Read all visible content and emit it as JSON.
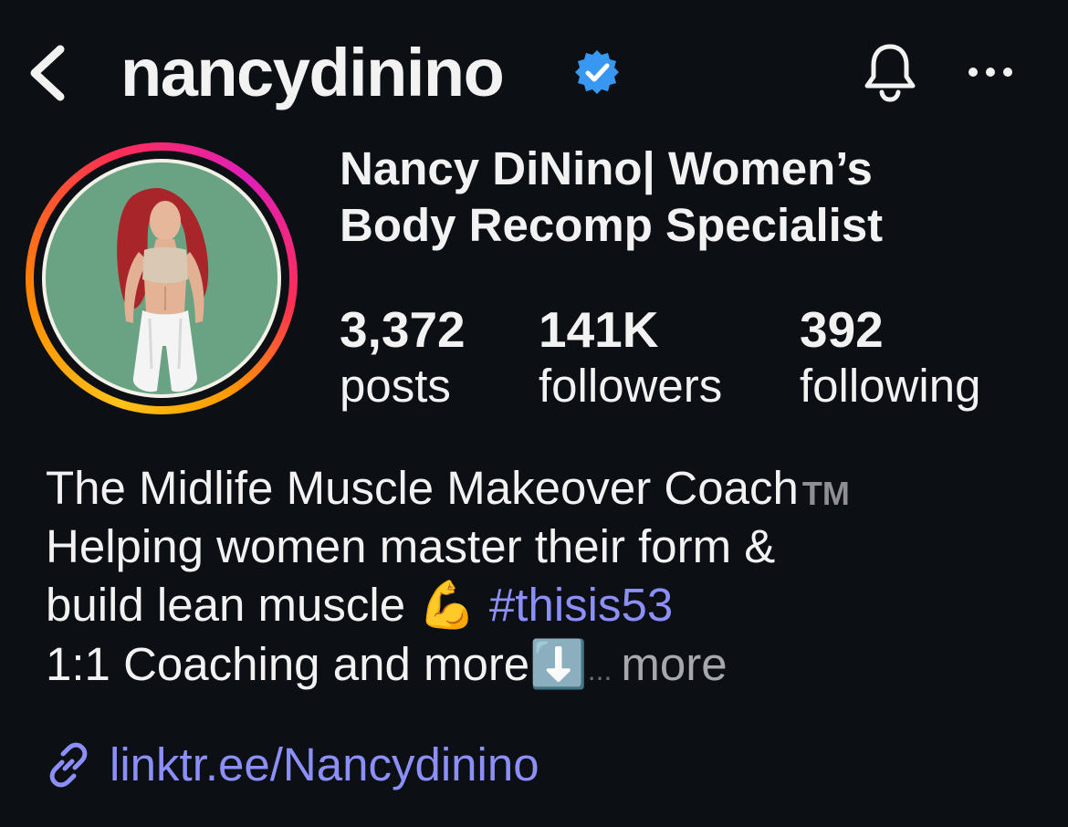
{
  "header": {
    "username": "nancydinino",
    "verified": true
  },
  "profile": {
    "display_name_line1": "Nancy DiNino| Women’s",
    "display_name_line2": "Body Recomp Specialist"
  },
  "stats": {
    "posts": {
      "count": "3,372",
      "label": "posts"
    },
    "followers": {
      "count": "141K",
      "label": "followers"
    },
    "following": {
      "count": "392",
      "label": "following"
    }
  },
  "bio": {
    "line1": "The Midlife Muscle Makeover Coach",
    "trademark": "TM",
    "line2": "Helping women master their form &",
    "line3_text": "build lean muscle",
    "line3_emoji": "💪",
    "hashtag": "#thisis53",
    "line4_text": "1:1 Coaching and more",
    "line4_emoji": "⬇️",
    "ellipsis": "...",
    "more_label": "more"
  },
  "link": {
    "icon": "link-icon",
    "text": "linktr.ee/Nancydinino"
  },
  "colors": {
    "background": "#0c0f14",
    "text": "#f2f2f2",
    "link": "#8b8ff7",
    "verified": "#3897f0",
    "muted": "#a7a8ad"
  }
}
